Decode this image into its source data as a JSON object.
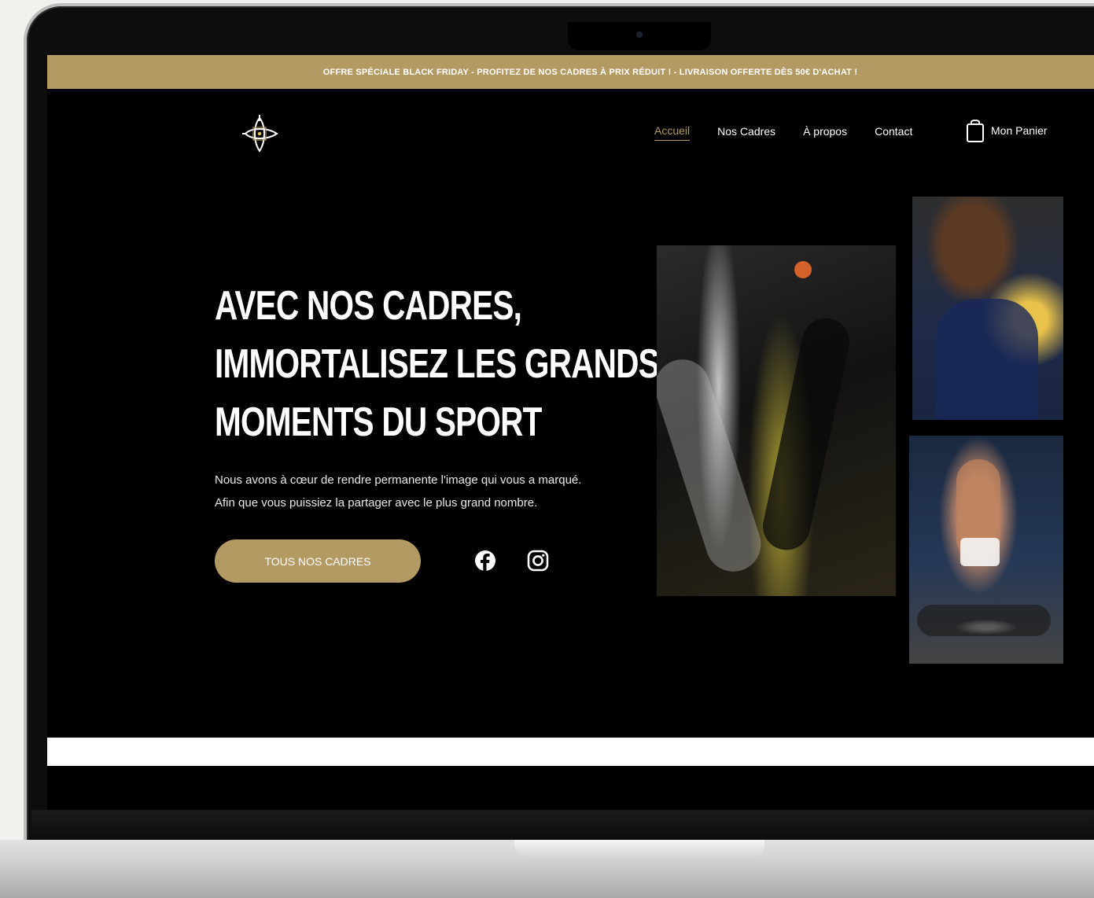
{
  "promo": {
    "text": "OFFRE SPÉCIALE BLACK FRIDAY - PROFITEZ DE NOS CADRES À PRIX RÉDUIT ! - LIVRAISON OFFERTE DÈS 50€ D'ACHAT !"
  },
  "nav": {
    "items": [
      {
        "label": "Accueil",
        "active": true
      },
      {
        "label": "Nos Cadres"
      },
      {
        "label": "À propos"
      },
      {
        "label": "Contact"
      }
    ],
    "cart_label": "Mon Panier"
  },
  "hero": {
    "title_lines": [
      "AVEC NOS CADRES,",
      "IMMORTALISEZ LES GRANDS",
      "MOMENTS DU SPORT"
    ],
    "description_lines": [
      "Nous avons à cœur de rendre permanente l'image qui vous a marqué.",
      "Afin que vous puissiez la partager avec le plus grand nombre."
    ],
    "cta_label": "TOUS NOS CADRES"
  },
  "social": {
    "icons": [
      "facebook-icon",
      "instagram-icon"
    ]
  },
  "colors": {
    "accent": "#b39a63",
    "background": "#000000"
  }
}
